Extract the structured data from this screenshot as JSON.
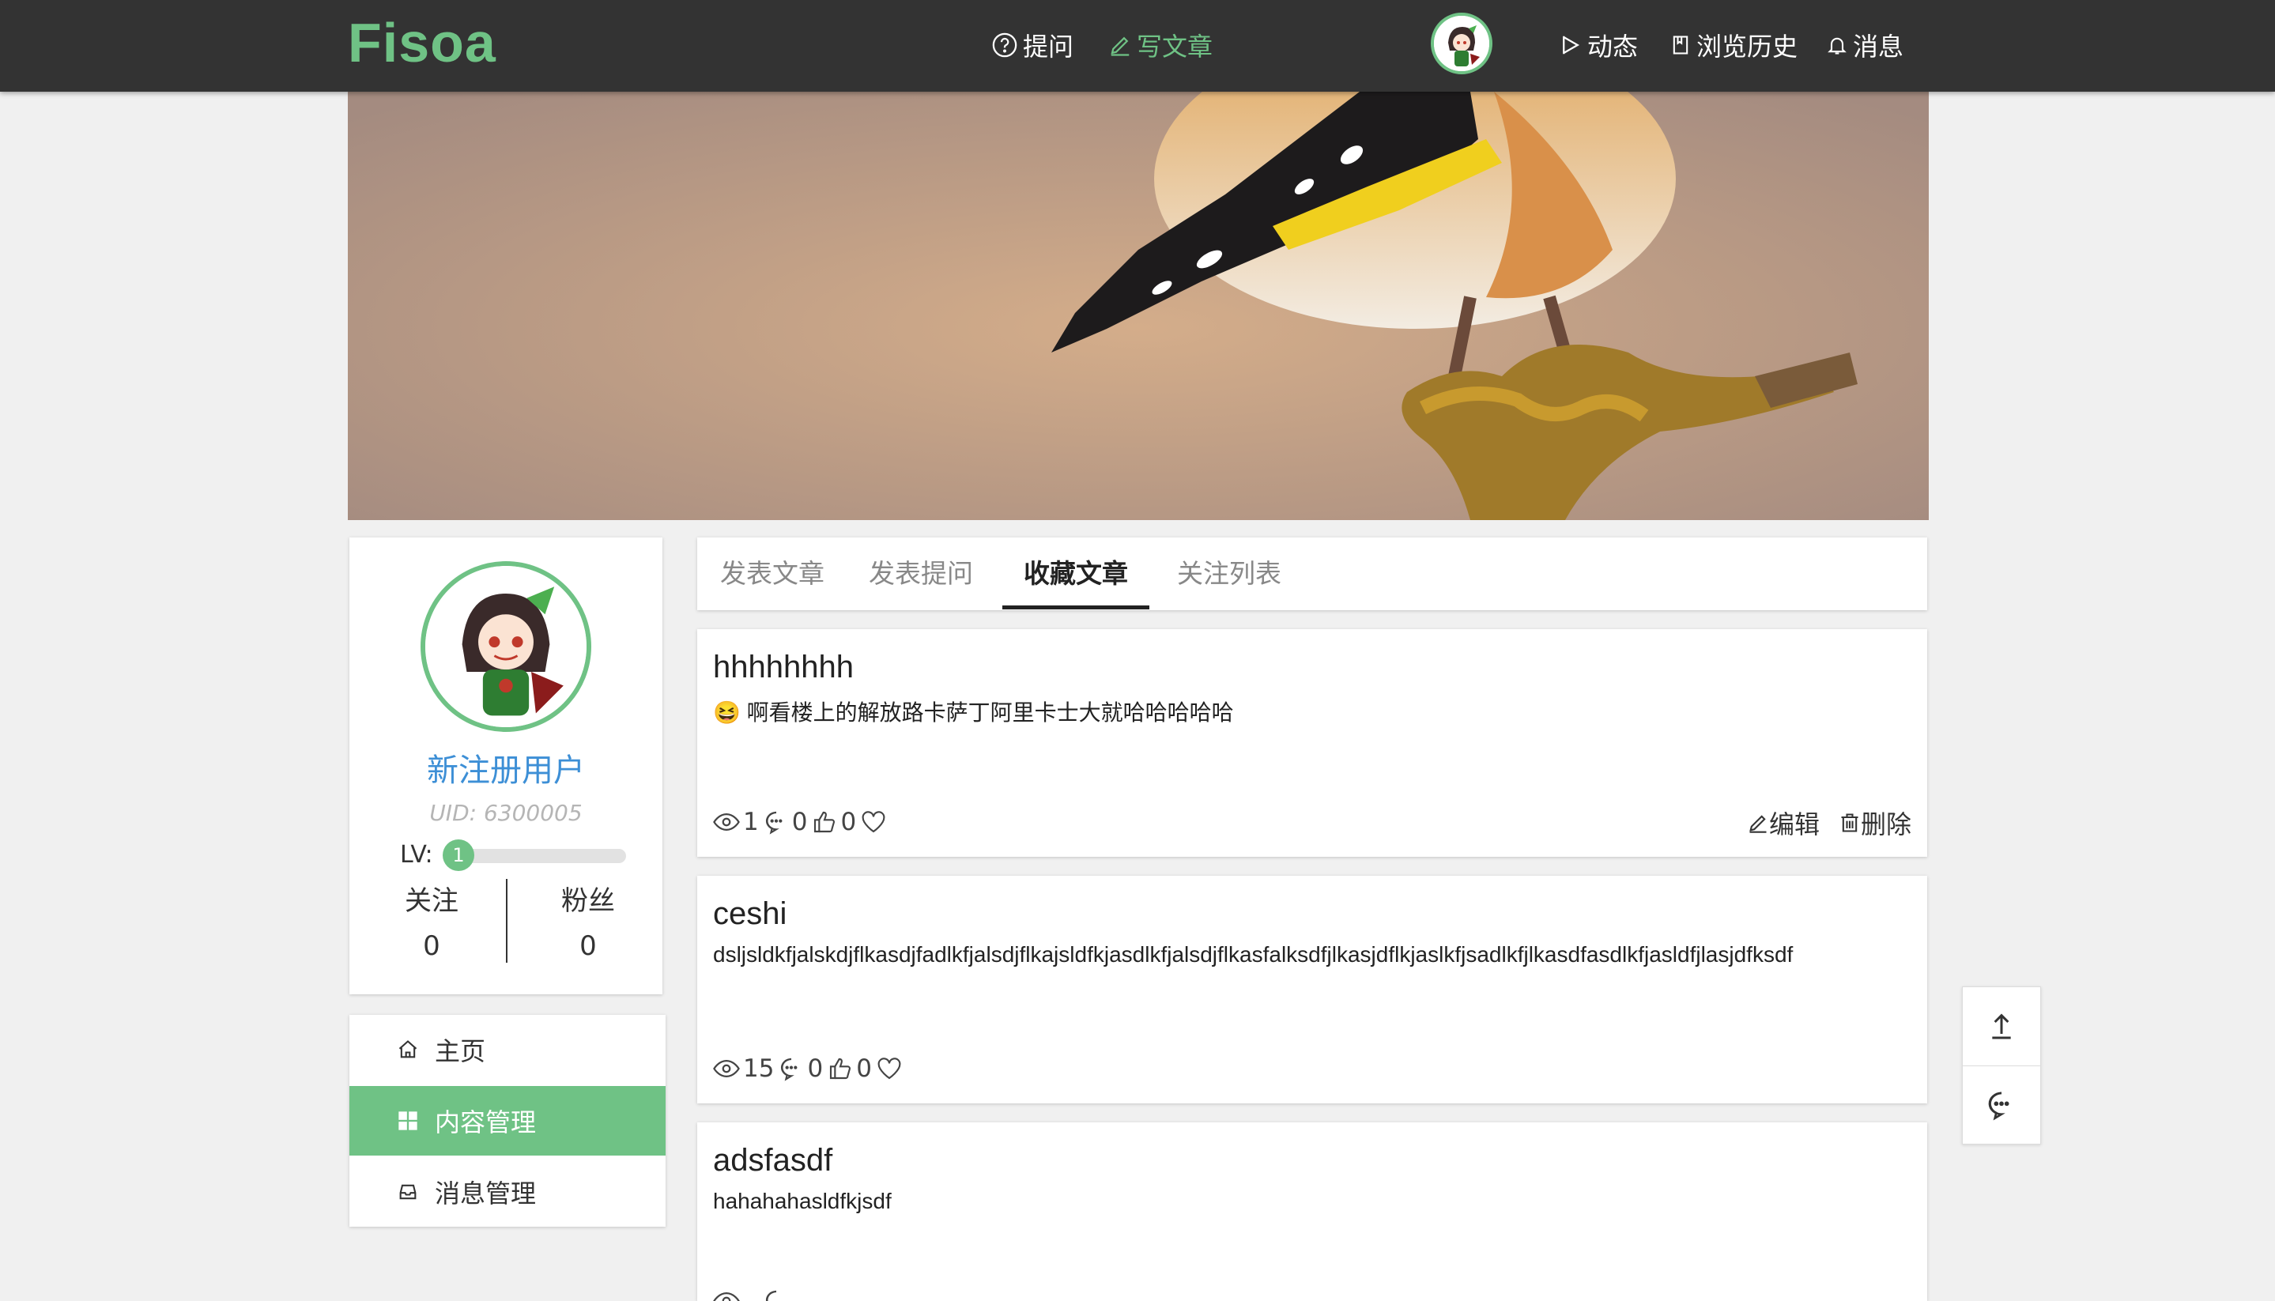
{
  "brand": {
    "logo": "Fisoa",
    "accent": "#6fc285",
    "topbar_bg": "#333333"
  },
  "nav": {
    "ask": "提问",
    "write": "写文章",
    "activity": "动态",
    "history": "浏览历史",
    "messages": "消息"
  },
  "profile": {
    "name": "新注册用户",
    "uid": "UID: 6300005",
    "level_label": "LV:",
    "level": "1",
    "level_progress": 0.12,
    "following_label": "关注",
    "following_count": "0",
    "followers_label": "粉丝",
    "followers_count": "0"
  },
  "menu": {
    "items": [
      {
        "label": "主页",
        "icon": "home-icon",
        "active": false
      },
      {
        "label": "内容管理",
        "icon": "grid-icon",
        "active": true
      },
      {
        "label": "消息管理",
        "icon": "inbox-icon",
        "active": false
      }
    ]
  },
  "tabs": {
    "items": [
      {
        "label": "发表文章",
        "active": false
      },
      {
        "label": "发表提问",
        "active": false
      },
      {
        "label": "收藏文章",
        "active": true
      },
      {
        "label": "关注列表",
        "active": false
      }
    ]
  },
  "posts": [
    {
      "title": "hhhhhhhh",
      "excerpt": "😆 啊看楼上的解放路卡萨丁阿里卡士大就哈哈哈哈哈",
      "views": "1",
      "comments": "0",
      "likes": "0",
      "edit_label": "编辑",
      "delete_label": "删除"
    },
    {
      "title": "ceshi",
      "excerpt": "dsljsldkfjalskdjflkasdjfadlkfjalsdjflkajsldfkjasdlkfjalsdjflkasfalksdfjlkasjdflkjaslkfjsadlkfjlkasdfasdlkfjasldfjlasjdfksdf",
      "views": "15",
      "comments": "0",
      "likes": "0"
    },
    {
      "title": "adsfasdf",
      "excerpt": "hahahahasldfkjsdf"
    }
  ],
  "floating": {
    "top_icon": "arrow-up-icon",
    "chat_icon": "chat-icon"
  }
}
